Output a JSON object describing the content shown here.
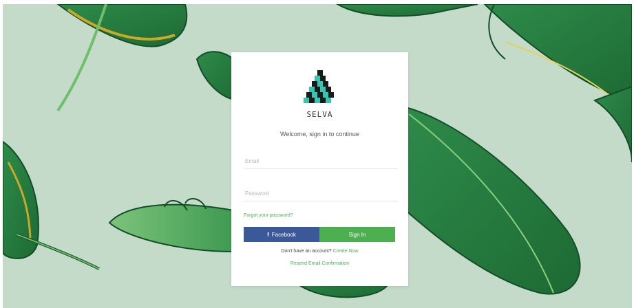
{
  "brand": {
    "name": "SELVA",
    "logo_icon": "pyramid-cubes-icon"
  },
  "login": {
    "welcome": "Welcome, sign in to continue",
    "email_placeholder": "Email",
    "password_placeholder": "Password",
    "forgot_label": "Forgot your password?",
    "facebook_label": "Facebook",
    "facebook_icon": "f",
    "signin_label": "Sign In",
    "no_account_text": "Don't have an account?",
    "create_label": "Create Now",
    "resend_label": "Resend Email Confirmation"
  },
  "colors": {
    "background": "#c5dbca",
    "facebook": "#3b5998",
    "accent": "#4caf50",
    "leaf_dark": "#1f6b35",
    "leaf_light": "#5fae5e"
  }
}
